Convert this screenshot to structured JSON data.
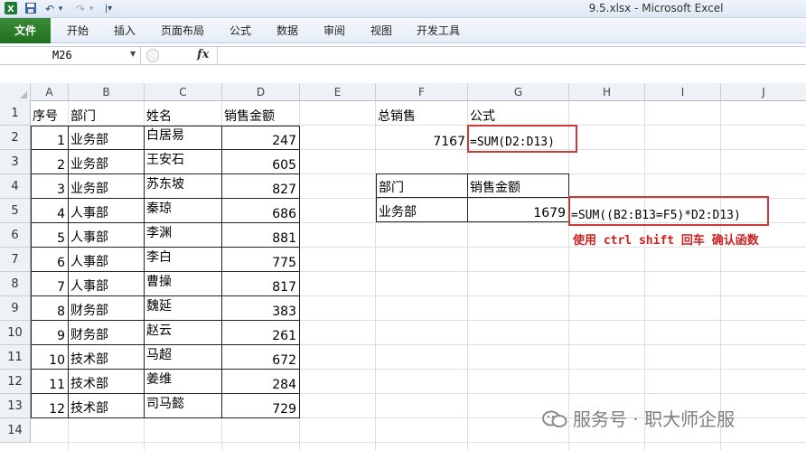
{
  "titlebar": {
    "title": "9.5.xlsx  -  Microsoft Excel",
    "undo_glyph": "↶",
    "redo_glyph": "↷",
    "dropdown_glyph": "▾",
    "customize_glyph": "|▾"
  },
  "ribbon": {
    "tabs": [
      "文件",
      "开始",
      "插入",
      "页面布局",
      "公式",
      "数据",
      "审阅",
      "视图",
      "开发工具"
    ],
    "file_color": "#2a7d2a"
  },
  "formula_bar": {
    "name_box": "M26",
    "fx_label": "fx",
    "formula": ""
  },
  "grid": {
    "columns": [
      "A",
      "B",
      "C",
      "D",
      "E",
      "F",
      "G",
      "H",
      "I",
      "J"
    ],
    "rows": [
      "1",
      "2",
      "3",
      "4",
      "5",
      "6",
      "7",
      "8",
      "9",
      "10",
      "11",
      "12",
      "13",
      "14"
    ]
  },
  "table": {
    "headers": [
      "序号",
      "部门",
      "姓名",
      "销售金额"
    ],
    "rows": [
      [
        "1",
        "业务部",
        "白居易",
        "247"
      ],
      [
        "2",
        "业务部",
        "王安石",
        "605"
      ],
      [
        "3",
        "业务部",
        "苏东坡",
        "827"
      ],
      [
        "4",
        "人事部",
        "秦琼",
        "686"
      ],
      [
        "5",
        "人事部",
        "李渊",
        "881"
      ],
      [
        "6",
        "人事部",
        "李白",
        "775"
      ],
      [
        "7",
        "人事部",
        "曹操",
        "817"
      ],
      [
        "8",
        "财务部",
        "魏延",
        "383"
      ],
      [
        "9",
        "财务部",
        "赵云",
        "261"
      ],
      [
        "10",
        "技术部",
        "马超",
        "672"
      ],
      [
        "11",
        "技术部",
        "姜维",
        "284"
      ],
      [
        "12",
        "技术部",
        "司马懿",
        "729"
      ]
    ]
  },
  "summary": {
    "total_label": "总销售",
    "formula_label": "公式",
    "total_value": "7167",
    "total_formula": "=SUM(D2:D13)"
  },
  "lookup": {
    "dept_label": "部门",
    "amount_label": "销售金额",
    "dept_value": "业务部",
    "amount_value": "1679",
    "array_formula": "=SUM((B2:B13=F5)*D2:D13)",
    "note": "使用 ctrl shift 回车 确认函数"
  },
  "watermark": {
    "text": "服务号 · 职大师企服"
  },
  "colors": {
    "highlight_red": "#d0393a",
    "note_red": "#cc2222",
    "header_bg": "#eef1f5"
  }
}
